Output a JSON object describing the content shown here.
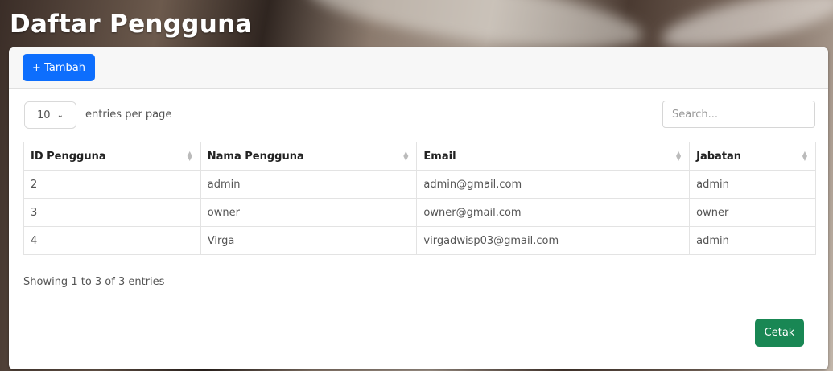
{
  "page": {
    "title": "Daftar Pengguna"
  },
  "toolbar": {
    "add_label": "+ Tambah"
  },
  "table_controls": {
    "per_page_value": "10",
    "per_page_label": "entries per page",
    "search_placeholder": "Search..."
  },
  "table": {
    "headers": [
      "ID Pengguna",
      "Nama Pengguna",
      "Email",
      "Jabatan"
    ],
    "rows": [
      [
        "2",
        "admin",
        "admin@gmail.com",
        "admin"
      ],
      [
        "3",
        "owner",
        "owner@gmail.com",
        "owner"
      ],
      [
        "4",
        "Virga",
        "virgadwisp03@gmail.com",
        "admin"
      ]
    ]
  },
  "footer": {
    "info": "Showing 1 to 3 of 3 entries",
    "print_label": "Cetak"
  },
  "colors": {
    "primary": "#0d6efd",
    "success": "#198754"
  }
}
